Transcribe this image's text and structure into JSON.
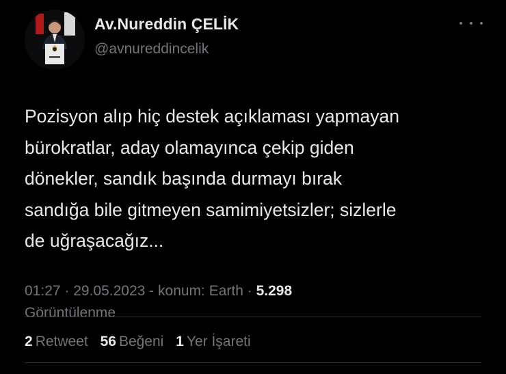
{
  "tweet": {
    "author": {
      "display_name": "Av.Nureddin ÇELİK",
      "handle": "@avnureddincelik"
    },
    "text": "Pozisyon alıp hiç destek açıklaması yapmayan\nbürokratlar, aday olamayınca çekip giden\ndönekler, sandık başında durmayı bırak\nsandığa bile gitmeyen samimiyetsizler; sizlerle\nde uğraşacağız...",
    "time": "01:27",
    "date": "29.05.2023",
    "location": "konum: Earth",
    "views_count": "5.298",
    "views_label": "Görüntülenme"
  },
  "stats": {
    "retweets": {
      "count": "2",
      "label": "Retweet"
    },
    "likes": {
      "count": "56",
      "label": "Beğeni"
    },
    "bookmarks": {
      "count": "1",
      "label": "Yer İşareti"
    }
  },
  "icons": {
    "more": "more-horizontal-icon"
  },
  "colors": {
    "background": "#000000",
    "primary_text": "#e7e9ea",
    "secondary_text": "#71767b",
    "divider": "#2f3336"
  }
}
